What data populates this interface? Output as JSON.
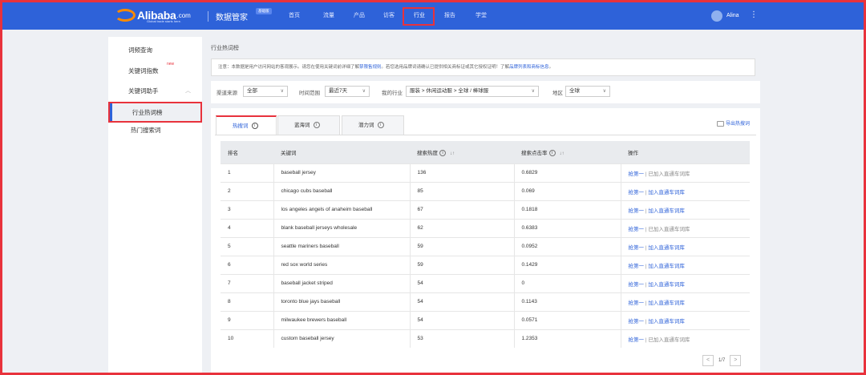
{
  "header": {
    "logo_text": "Alibaba",
    "logo_dotcom": ".com",
    "logo_tagline": "Global trade starts here.",
    "app_title": "数据管家",
    "edition_badge": "基础版",
    "nav": [
      {
        "label": "首页",
        "active": false
      },
      {
        "label": "流量",
        "active": false
      },
      {
        "label": "产品",
        "active": false
      },
      {
        "label": "访客",
        "active": false
      },
      {
        "label": "行业",
        "active": true
      },
      {
        "label": "报告",
        "active": false
      },
      {
        "label": "学堂",
        "active": false
      }
    ],
    "username": "Alina",
    "more_icon": "⋮"
  },
  "sidebar": {
    "items": [
      {
        "label": "词频查询"
      },
      {
        "label": "关键词指数",
        "badge": "new"
      },
      {
        "label": "关键词助手",
        "chevron": "︿"
      },
      {
        "label": "行业热词榜",
        "active": true
      },
      {
        "label": "热门搜索词"
      }
    ]
  },
  "main": {
    "page_title": "行业热词榜",
    "notice": {
      "text_before": "注意：本数据是用户访问网站的客观展示。请您在使用关键词前详细了解",
      "link1": "禁限售规则",
      "text_middle": "。若您选用品牌词请确认已提供相关商标证或其它授权证明！了解",
      "link2": "品牌列表和商标信息",
      "text_after": "。"
    },
    "filters": {
      "channel_label": "渠道来源",
      "channel_value": "全部",
      "time_label": "时间范围",
      "time_value": "最近7天",
      "industry_label": "我的行业",
      "industry_value": "服装 > 休闲运动服 > 全球 / 棒球服",
      "region_label": "地区",
      "region_value": "全球"
    },
    "tabs": [
      {
        "label": "热搜词",
        "active": true
      },
      {
        "label": "蓝海词",
        "active": false
      },
      {
        "label": "潜力词",
        "active": false
      }
    ],
    "export_label": "导出热搜词",
    "table": {
      "headers": [
        "排名",
        "关键词",
        "搜索热度",
        "搜索点击率",
        "操作"
      ],
      "rows": [
        {
          "rank": "1",
          "keyword": "baseball jersey",
          "heat": "136",
          "ctr": "0.6829",
          "act1": "抢第一",
          "sep": " | ",
          "act2": "已加入直通车词库",
          "added": true
        },
        {
          "rank": "2",
          "keyword": "chicago cubs baseball",
          "heat": "85",
          "ctr": "0.069",
          "act1": "抢第一",
          "sep": " | ",
          "act2": "加入直通车词库",
          "added": false
        },
        {
          "rank": "3",
          "keyword": "los angeles angels of anaheim baseball",
          "heat": "67",
          "ctr": "0.1818",
          "act1": "抢第一",
          "sep": " | ",
          "act2": "加入直通车词库",
          "added": false
        },
        {
          "rank": "4",
          "keyword": "blank baseball jerseys wholesale",
          "heat": "62",
          "ctr": "0.6383",
          "act1": "抢第一",
          "sep": " | ",
          "act2": "已加入直通车词库",
          "added": true
        },
        {
          "rank": "5",
          "keyword": "seattle mariners baseball",
          "heat": "59",
          "ctr": "0.0952",
          "act1": "抢第一",
          "sep": " | ",
          "act2": "加入直通车词库",
          "added": false
        },
        {
          "rank": "6",
          "keyword": "red sox world series",
          "heat": "59",
          "ctr": "0.1429",
          "act1": "抢第一",
          "sep": " | ",
          "act2": "加入直通车词库",
          "added": false
        },
        {
          "rank": "7",
          "keyword": "baseball jacket striped",
          "heat": "54",
          "ctr": "0",
          "act1": "抢第一",
          "sep": " | ",
          "act2": "加入直通车词库",
          "added": false
        },
        {
          "rank": "8",
          "keyword": "toronto blue jays baseball",
          "heat": "54",
          "ctr": "0.1143",
          "act1": "抢第一",
          "sep": " | ",
          "act2": "加入直通车词库",
          "added": false
        },
        {
          "rank": "9",
          "keyword": "milwaukee brewers baseball",
          "heat": "54",
          "ctr": "0.0571",
          "act1": "抢第一",
          "sep": " | ",
          "act2": "加入直通车词库",
          "added": false
        },
        {
          "rank": "10",
          "keyword": "custom baseball jersey",
          "heat": "53",
          "ctr": "1.2353",
          "act1": "抢第一",
          "sep": " | ",
          "act2": "已加入直通车词库",
          "added": true
        }
      ]
    },
    "pagination": {
      "info": "1/7",
      "prev": "<",
      "next": ">"
    }
  },
  "colors": {
    "brand": "#2e62d9",
    "highlight": "#e8323c",
    "orange": "#ff8a00"
  }
}
